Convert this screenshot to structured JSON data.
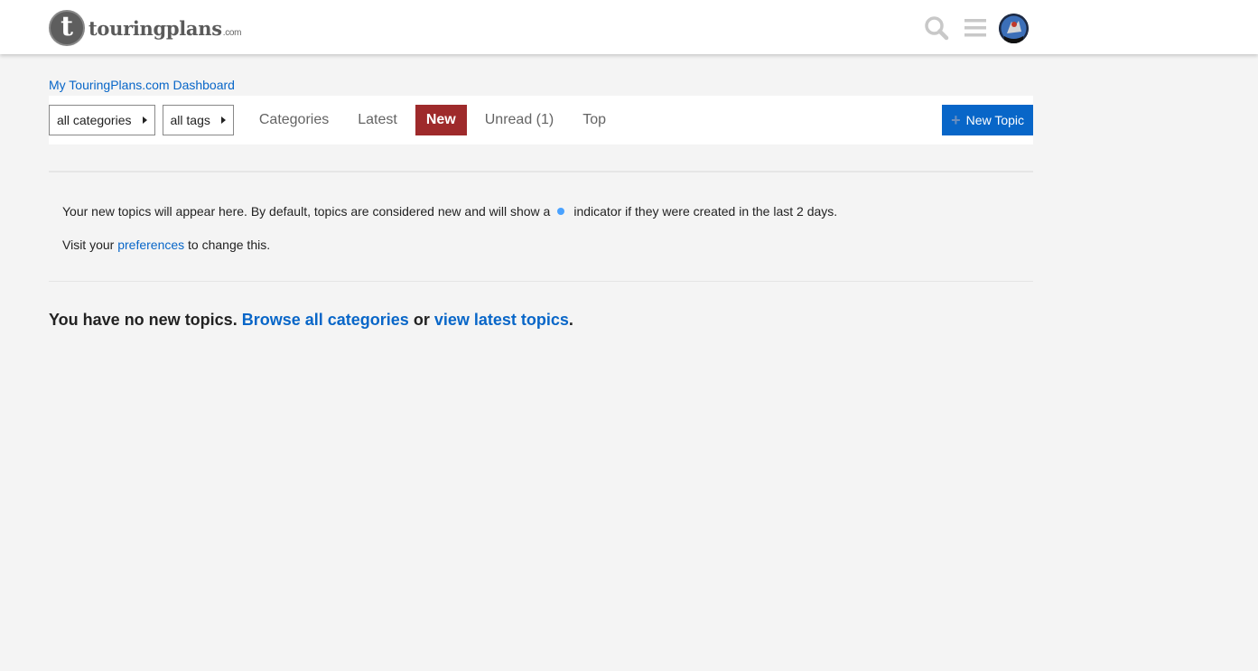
{
  "site": {
    "logo_letter": "t",
    "logo_name": "touringplans",
    "logo_suffix": ".com"
  },
  "header": {
    "icons": [
      "search-icon",
      "hamburger-menu-icon",
      "user-avatar"
    ]
  },
  "breadcrumb": {
    "dashboard_link": "My TouringPlans.com Dashboard"
  },
  "nav": {
    "category_dropdown": "all categories",
    "tag_dropdown": "all tags",
    "items": [
      {
        "label": "Categories",
        "active": false
      },
      {
        "label": "Latest",
        "active": false
      },
      {
        "label": "New",
        "active": true
      },
      {
        "label": "Unread (1)",
        "active": false
      },
      {
        "label": "Top",
        "active": false
      }
    ],
    "new_topic_button": "New Topic"
  },
  "info": {
    "line1_before": "Your new topics will appear here. By default, topics are considered new and will show a",
    "line1_after": "indicator if they were created in the last 2 days.",
    "line2_before": "Visit your",
    "line2_link": "preferences",
    "line2_after": "to change this."
  },
  "empty_state": {
    "text_before": "You have no new topics.",
    "browse_link": "Browse all categories",
    "middle": "or",
    "latest_link": "view latest topics",
    "end": "."
  },
  "colors": {
    "accent_blue": "#0866c8",
    "active_tab": "#9e2a2b",
    "new_indicator": "#4aa2ff",
    "background": "#f4f4f4"
  }
}
